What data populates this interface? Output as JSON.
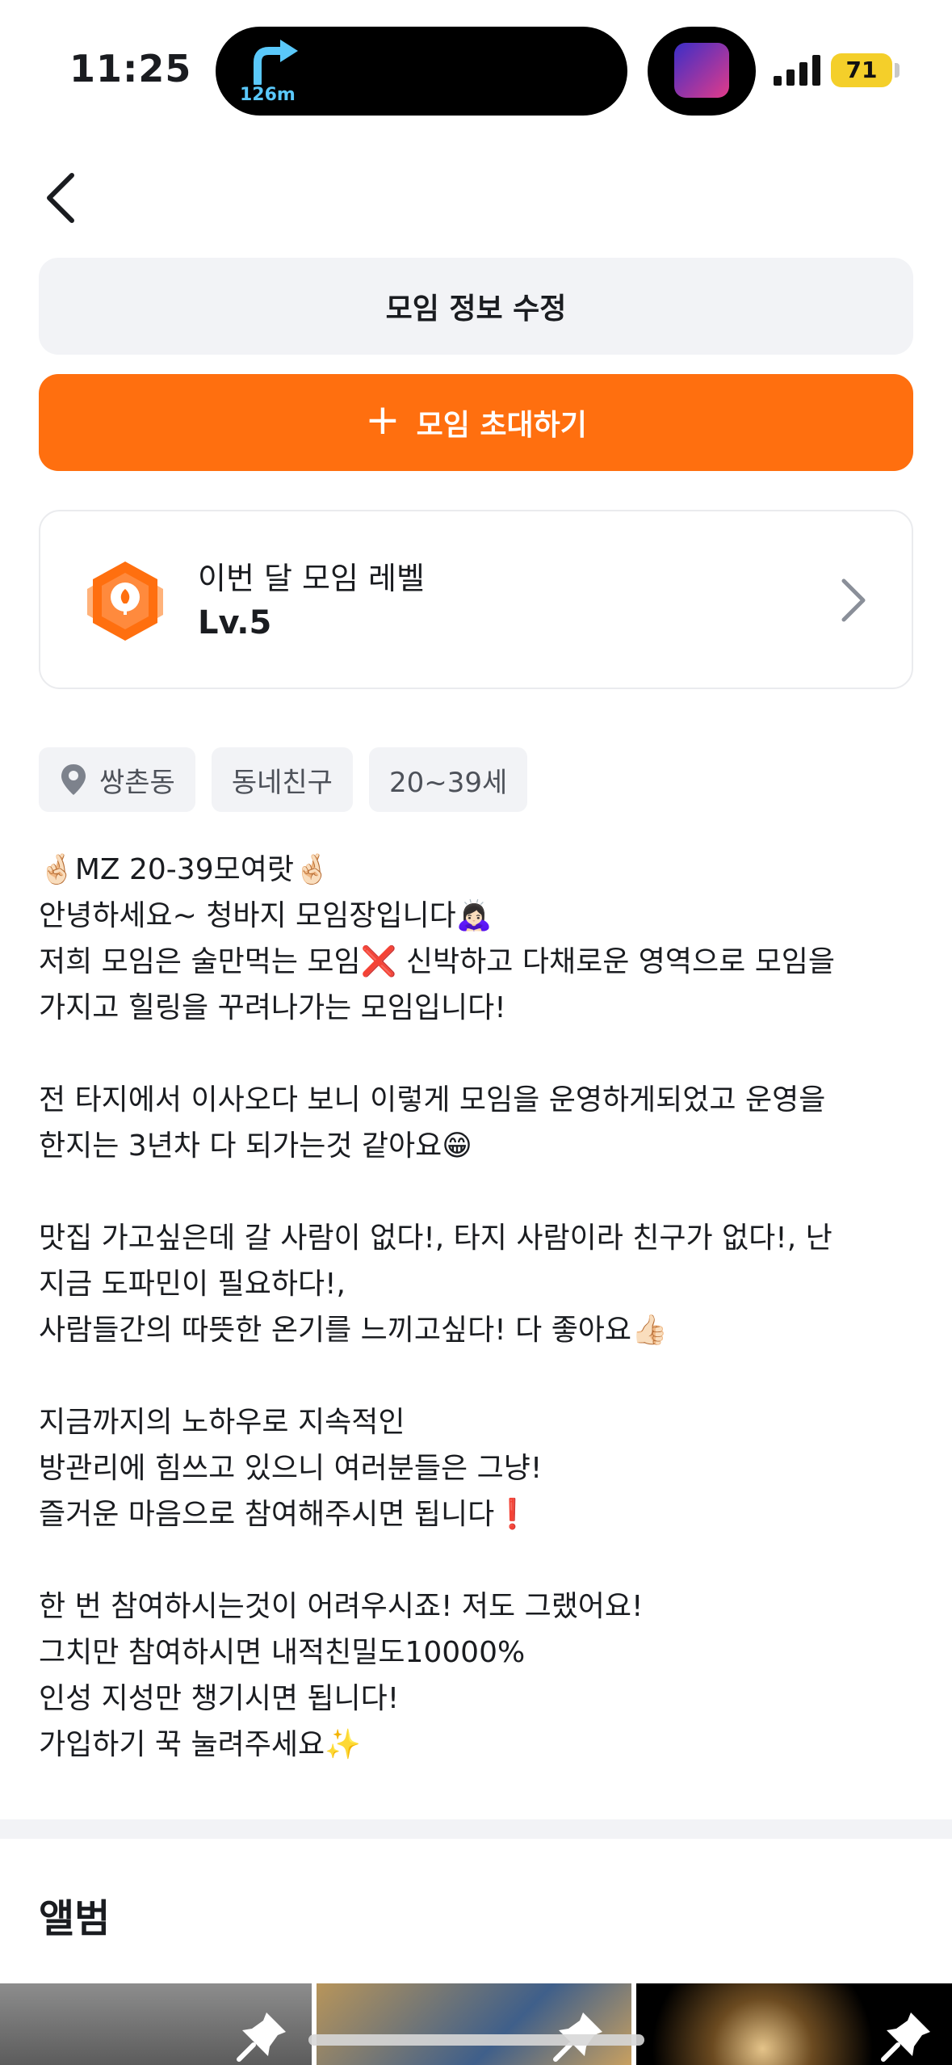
{
  "status_bar": {
    "time": "11:25",
    "navigation_distance": "126m",
    "battery_level": "71"
  },
  "actions": {
    "edit_label": "모임 정보 수정",
    "invite_plus": "+",
    "invite_label": "모임 초대하기"
  },
  "level_card": {
    "title": "이번 달 모임 레벨",
    "value": "Lv.5"
  },
  "tags": {
    "location": "쌍촌동",
    "category": "동네친구",
    "age": "20~39세"
  },
  "intro_lines": [
    "🤞🏻MZ 20-39모여랏🤞🏻",
    "안녕하세요~ 청바지 모임장입니다🙇🏻‍♀️",
    "저희 모임은 술만먹는 모임❌ 신박하고 다채로운 영역으로 모임을",
    "가지고 힐링을 꾸려나가는 모임입니다!",
    "",
    "전 타지에서 이사오다 보니 이렇게 모임을 운영하게되었고 운영을",
    "한지는 3년차 다 되가는것 같아요😁",
    "",
    "맛집 가고싶은데 갈 사람이 없다!, 타지 사람이라 친구가 없다!, 난",
    "지금 도파민이 필요하다!,",
    "사람들간의 따뜻한 온기를 느끼고싶다! 다 좋아요👍🏻",
    "",
    "지금까지의 노하우로 지속적인",
    "방관리에 힘쓰고 있으니 여러분들은 그냥!",
    "즐거운 마음으로 참여해주시면 됩니다❗️",
    "",
    "한 번 참여하시는것이 어려우시죠! 저도 그랬어요!",
    "그치만  참여하시면 내적친밀도10000%",
    "인성 지성만 챙기시면 됩니다!",
    "가입하기 꾹 눌려주세요✨"
  ],
  "album": {
    "title": "앨범"
  },
  "colors": {
    "accent": "#ff6f0f",
    "chip_bg": "#f2f3f6",
    "text": "#1a1c20"
  },
  "icons": [
    "back-chevron-icon",
    "plus-icon",
    "level-badge-icon",
    "chevron-right-icon",
    "location-pin-icon",
    "pin-icon"
  ]
}
